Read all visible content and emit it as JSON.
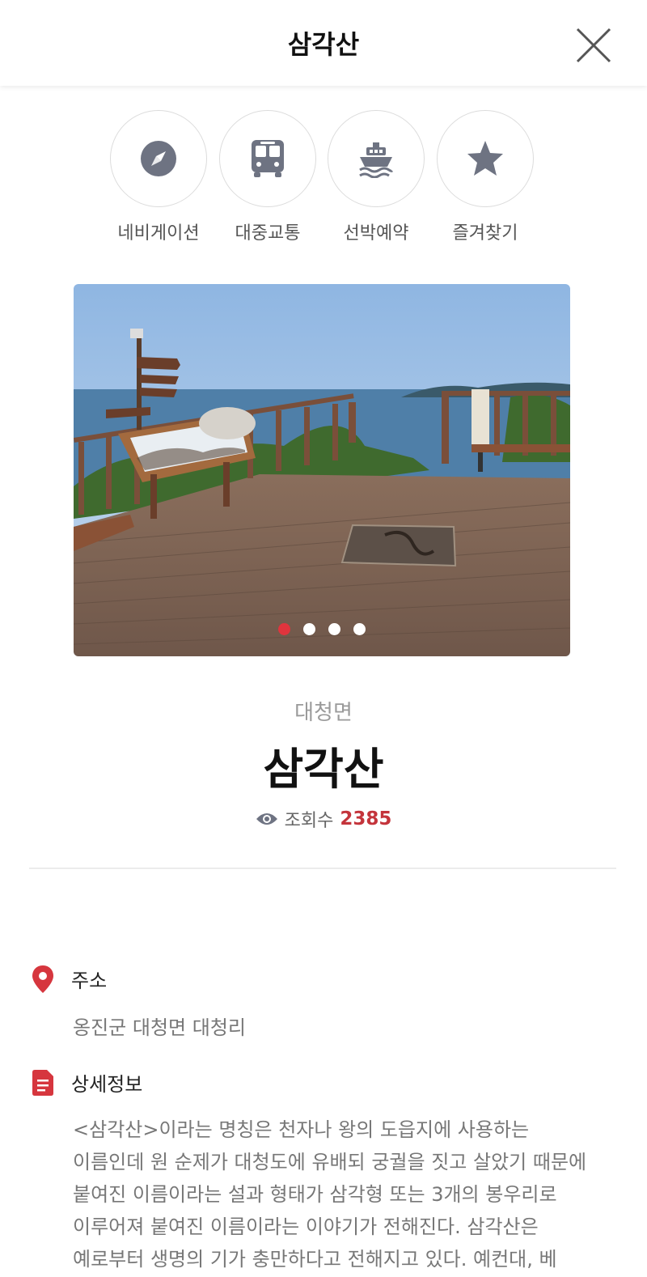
{
  "header": {
    "title": "삼각산"
  },
  "actions": [
    {
      "label": "네비게이션",
      "icon": "compass-icon"
    },
    {
      "label": "대중교통",
      "icon": "bus-icon"
    },
    {
      "label": "선박예약",
      "icon": "ship-icon"
    },
    {
      "label": "즐겨찾기",
      "icon": "star-icon"
    }
  ],
  "gallery": {
    "total": 4,
    "active_index": 0
  },
  "place": {
    "region": "대청면",
    "name": "삼각산",
    "views_label": "조회수",
    "views_count": "2385"
  },
  "address": {
    "label": "주소",
    "value": "옹진군 대청면 대청리"
  },
  "details": {
    "label": "상세정보",
    "text": "<삼각산>이라는 명칭은 천자나 왕의 도읍지에 사용하는 이름인데 원 순제가 대청도에 유배되 궁궐을 짓고 살았기 때문에 붙여진 이름이라는 설과 형태가 삼각형 또는 3개의 봉우리로 이루어져 붙여진 이름이라는 이야기가 전해진다. 삼각산은 예로부터 생명의 기가 충만하다고 전해지고 있다. 예컨대, 베"
  },
  "colors": {
    "accent": "#e0343d",
    "icon_gray": "#6e7382",
    "view_count": "#c4343b"
  }
}
